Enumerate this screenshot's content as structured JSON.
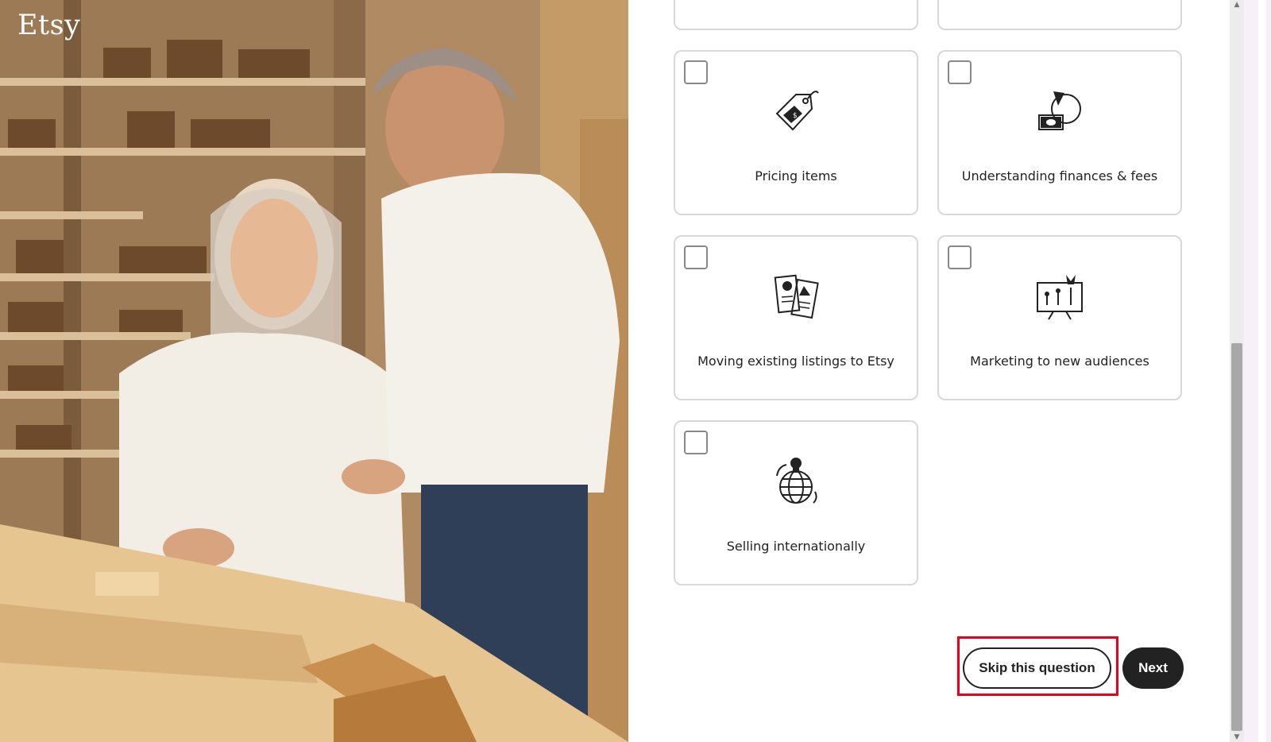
{
  "brand": {
    "logo": "Etsy"
  },
  "options": [
    {
      "label": "Pricing items",
      "icon": "price-tag-icon",
      "checked": false
    },
    {
      "label": "Understanding finances & fees",
      "icon": "finance-chart-icon",
      "checked": false
    },
    {
      "label": "Moving existing listings to Etsy",
      "icon": "listings-cards-icon",
      "checked": false
    },
    {
      "label": "Marketing to new audiences",
      "icon": "marketing-board-icon",
      "checked": false
    },
    {
      "label": "Selling internationally",
      "icon": "globe-icon",
      "checked": false
    }
  ],
  "actions": {
    "skip_label": "Skip this question",
    "next_label": "Next"
  },
  "colors": {
    "accent_dark": "#222222",
    "highlight_outline": "#e8001c"
  }
}
